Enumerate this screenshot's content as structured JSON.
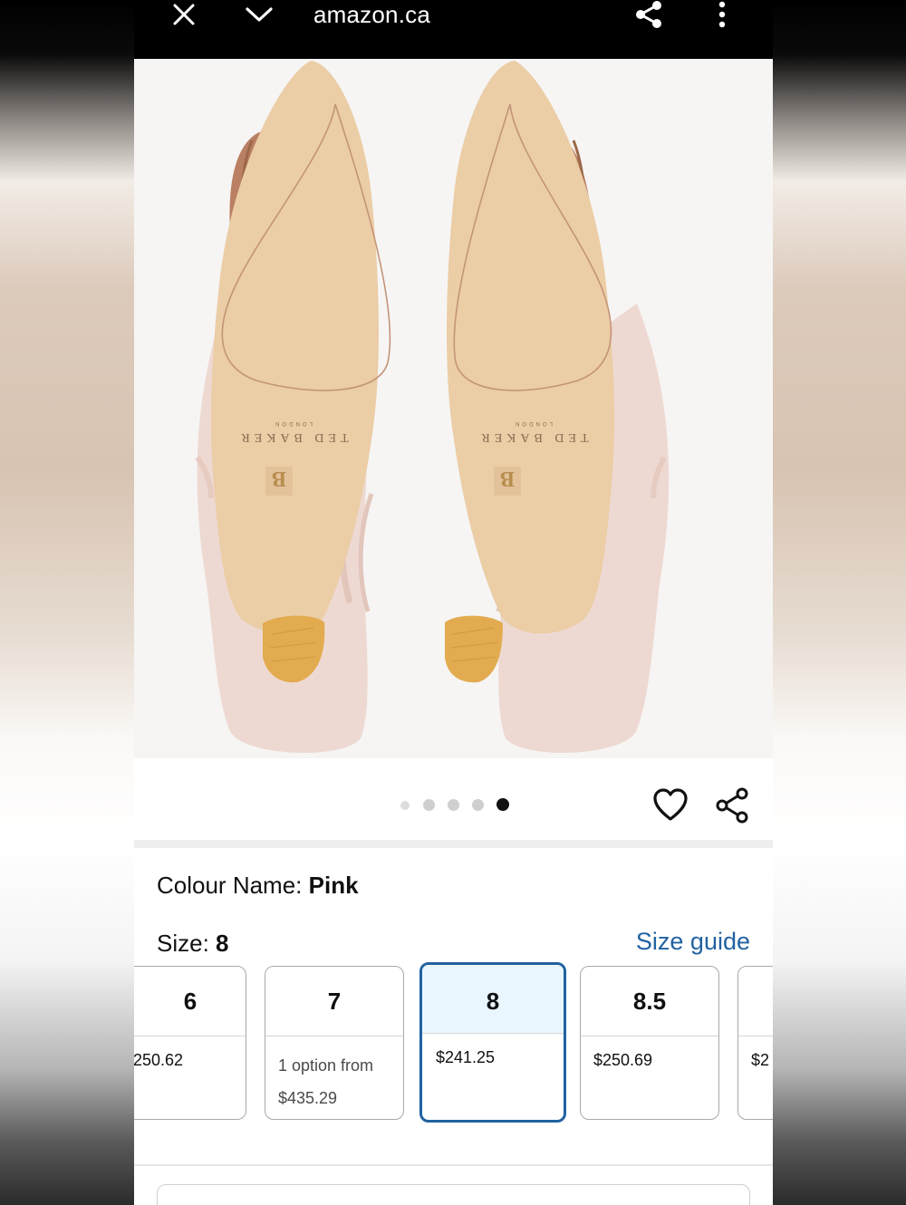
{
  "browser": {
    "url_text": "amazon.ca",
    "icons": [
      "close-icon",
      "chevron-down-icon",
      "share-icon",
      "more-vertical-icon"
    ]
  },
  "product_image": {
    "brand_text": "TED BAKER",
    "brand_sub": "LONDON",
    "monogram": "TB"
  },
  "carousel": {
    "total_dots": 5,
    "active_index": 4,
    "icons": [
      "heart-icon",
      "share-icon"
    ]
  },
  "colour": {
    "label": "Colour Name: ",
    "value": "Pink"
  },
  "size": {
    "label": "Size: ",
    "value": "8",
    "guide_link": "Size guide"
  },
  "size_options": [
    {
      "size": "6",
      "price": "$250.62",
      "visible_price": "250.62"
    },
    {
      "size": "7",
      "price": "",
      "option_line1": "1 option from",
      "option_line2": "$435.29"
    },
    {
      "size": "8",
      "price": "$241.25",
      "selected": true
    },
    {
      "size": "8.5",
      "price": "$250.69"
    },
    {
      "size": "",
      "price": "$2"
    }
  ],
  "colors": {
    "accent_blue": "#2162a1",
    "selected_bg": "#eaf6fe",
    "topbar": "#000000",
    "sole": "#e9caa3",
    "shoe_pink": "#eedad3"
  }
}
